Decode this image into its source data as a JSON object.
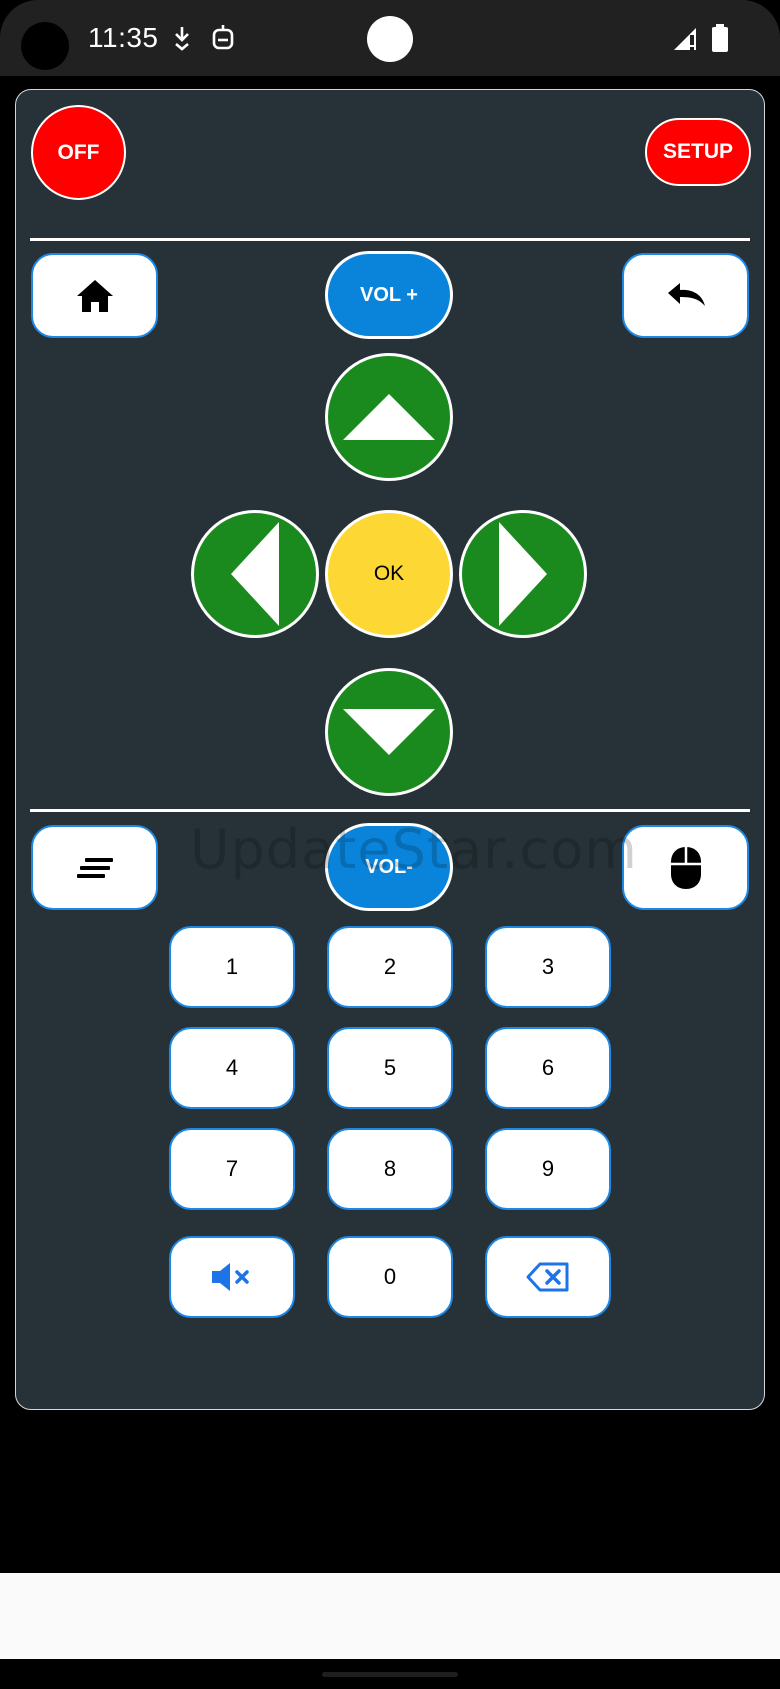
{
  "status_bar": {
    "time": "11:35"
  },
  "remote": {
    "off_label": "OFF",
    "setup_label": "SETUP",
    "vol_up_label": "VOL +",
    "vol_down_label": "VOL-",
    "ok_label": "OK",
    "keypad": [
      "1",
      "2",
      "3",
      "4",
      "5",
      "6",
      "7",
      "8",
      "9",
      "0"
    ]
  },
  "watermark": "UpdateStar.com",
  "colors": {
    "panel": "#263238",
    "power": "#fe0000",
    "volume": "#0a84db",
    "dpad": "#1b8a1e",
    "ok": "#fdd835",
    "accent": "#1e88e5"
  },
  "icons": {
    "home": "home-icon",
    "back": "undo-arrow-icon",
    "menu": "menu-lines-icon",
    "mouse": "mouse-icon",
    "mute": "mute-icon",
    "backspace": "backspace-icon"
  }
}
